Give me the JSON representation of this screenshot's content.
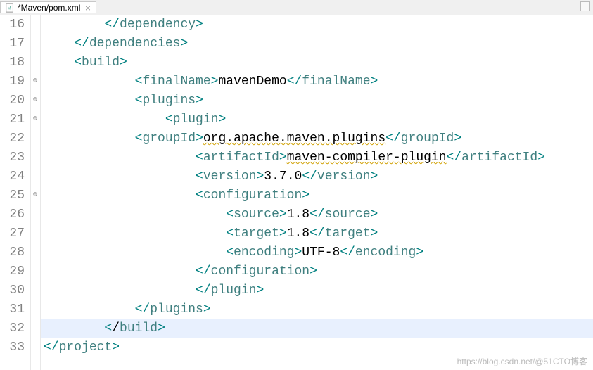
{
  "tab": {
    "title": "*Maven/pom.xml",
    "close_glyph": "⨯"
  },
  "gutter": {
    "start": 16,
    "end": 33
  },
  "fold_markers": [
    {
      "line": 19,
      "glyph": "⊖"
    },
    {
      "line": 20,
      "glyph": "⊖"
    },
    {
      "line": 21,
      "glyph": "⊖"
    },
    {
      "line": 25,
      "glyph": "⊖"
    }
  ],
  "highlighted_line": 32,
  "code_lines": [
    {
      "indent": "        ",
      "parts": [
        {
          "t": "bracket",
          "v": "</"
        },
        {
          "t": "tag",
          "v": "dependency"
        },
        {
          "t": "bracket",
          "v": ">"
        }
      ]
    },
    {
      "indent": "    ",
      "parts": [
        {
          "t": "bracket",
          "v": "</"
        },
        {
          "t": "tag",
          "v": "dependencies"
        },
        {
          "t": "bracket",
          "v": ">"
        }
      ]
    },
    {
      "indent": "    ",
      "parts": [
        {
          "t": "bracket",
          "v": "<"
        },
        {
          "t": "tag",
          "v": "build"
        },
        {
          "t": "bracket",
          "v": ">"
        }
      ]
    },
    {
      "indent": "            ",
      "parts": [
        {
          "t": "bracket",
          "v": "<"
        },
        {
          "t": "tag",
          "v": "finalName"
        },
        {
          "t": "bracket",
          "v": ">"
        },
        {
          "t": "text",
          "v": "mavenDemo"
        },
        {
          "t": "bracket",
          "v": "</"
        },
        {
          "t": "tag",
          "v": "finalName"
        },
        {
          "t": "bracket",
          "v": ">"
        }
      ]
    },
    {
      "indent": "            ",
      "parts": [
        {
          "t": "bracket",
          "v": "<"
        },
        {
          "t": "tag",
          "v": "plugins"
        },
        {
          "t": "bracket",
          "v": ">"
        }
      ]
    },
    {
      "indent": "                ",
      "parts": [
        {
          "t": "bracket",
          "v": "<"
        },
        {
          "t": "tag",
          "v": "plugin"
        },
        {
          "t": "bracket",
          "v": ">"
        }
      ]
    },
    {
      "indent": "            ",
      "parts": [
        {
          "t": "bracket",
          "v": "<"
        },
        {
          "t": "tag",
          "v": "groupId"
        },
        {
          "t": "bracket",
          "v": ">"
        },
        {
          "t": "text",
          "v": "org.apache.maven.plugins",
          "err": true
        },
        {
          "t": "bracket",
          "v": "</"
        },
        {
          "t": "tag",
          "v": "groupId"
        },
        {
          "t": "bracket",
          "v": ">"
        }
      ]
    },
    {
      "indent": "                    ",
      "parts": [
        {
          "t": "bracket",
          "v": "<"
        },
        {
          "t": "tag",
          "v": "artifactId"
        },
        {
          "t": "bracket",
          "v": ">"
        },
        {
          "t": "text",
          "v": "maven-compiler-plugin",
          "err": true
        },
        {
          "t": "bracket",
          "v": "</"
        },
        {
          "t": "tag",
          "v": "artifactId"
        },
        {
          "t": "bracket",
          "v": ">"
        }
      ]
    },
    {
      "indent": "                    ",
      "parts": [
        {
          "t": "bracket",
          "v": "<"
        },
        {
          "t": "tag",
          "v": "version"
        },
        {
          "t": "bracket",
          "v": ">"
        },
        {
          "t": "text",
          "v": "3.7.0"
        },
        {
          "t": "bracket",
          "v": "</"
        },
        {
          "t": "tag",
          "v": "version"
        },
        {
          "t": "bracket",
          "v": ">"
        }
      ]
    },
    {
      "indent": "                    ",
      "parts": [
        {
          "t": "bracket",
          "v": "<"
        },
        {
          "t": "tag",
          "v": "configuration"
        },
        {
          "t": "bracket",
          "v": ">"
        }
      ]
    },
    {
      "indent": "                        ",
      "parts": [
        {
          "t": "bracket",
          "v": "<"
        },
        {
          "t": "tag",
          "v": "source"
        },
        {
          "t": "bracket",
          "v": ">"
        },
        {
          "t": "text",
          "v": "1.8"
        },
        {
          "t": "bracket",
          "v": "</"
        },
        {
          "t": "tag",
          "v": "source"
        },
        {
          "t": "bracket",
          "v": ">"
        }
      ]
    },
    {
      "indent": "                        ",
      "parts": [
        {
          "t": "bracket",
          "v": "<"
        },
        {
          "t": "tag",
          "v": "target"
        },
        {
          "t": "bracket",
          "v": ">"
        },
        {
          "t": "text",
          "v": "1.8"
        },
        {
          "t": "bracket",
          "v": "</"
        },
        {
          "t": "tag",
          "v": "target"
        },
        {
          "t": "bracket",
          "v": ">"
        }
      ]
    },
    {
      "indent": "                        ",
      "parts": [
        {
          "t": "bracket",
          "v": "<"
        },
        {
          "t": "tag",
          "v": "encoding"
        },
        {
          "t": "bracket",
          "v": ">"
        },
        {
          "t": "text",
          "v": "UTF-8"
        },
        {
          "t": "bracket",
          "v": "</"
        },
        {
          "t": "tag",
          "v": "encoding"
        },
        {
          "t": "bracket",
          "v": ">"
        }
      ]
    },
    {
      "indent": "                    ",
      "parts": [
        {
          "t": "bracket",
          "v": "</"
        },
        {
          "t": "tag",
          "v": "configuration"
        },
        {
          "t": "bracket",
          "v": ">"
        }
      ]
    },
    {
      "indent": "                    ",
      "parts": [
        {
          "t": "bracket",
          "v": "</"
        },
        {
          "t": "tag",
          "v": "plugin"
        },
        {
          "t": "bracket",
          "v": ">"
        }
      ]
    },
    {
      "indent": "            ",
      "parts": [
        {
          "t": "bracket",
          "v": "</"
        },
        {
          "t": "tag",
          "v": "plugins"
        },
        {
          "t": "bracket",
          "v": ">"
        }
      ]
    },
    {
      "indent": "        ",
      "parts": [
        {
          "t": "bracket",
          "v": "<"
        },
        {
          "t": "text",
          "v": "/"
        },
        {
          "t": "tag",
          "v": "build"
        },
        {
          "t": "bracket",
          "v": ">"
        }
      ]
    },
    {
      "indent": "",
      "parts": [
        {
          "t": "bracket",
          "v": "</"
        },
        {
          "t": "tag",
          "v": "project"
        },
        {
          "t": "bracket",
          "v": ">"
        }
      ]
    }
  ],
  "watermark": "https://blog.csdn.net/@51CTO博客"
}
